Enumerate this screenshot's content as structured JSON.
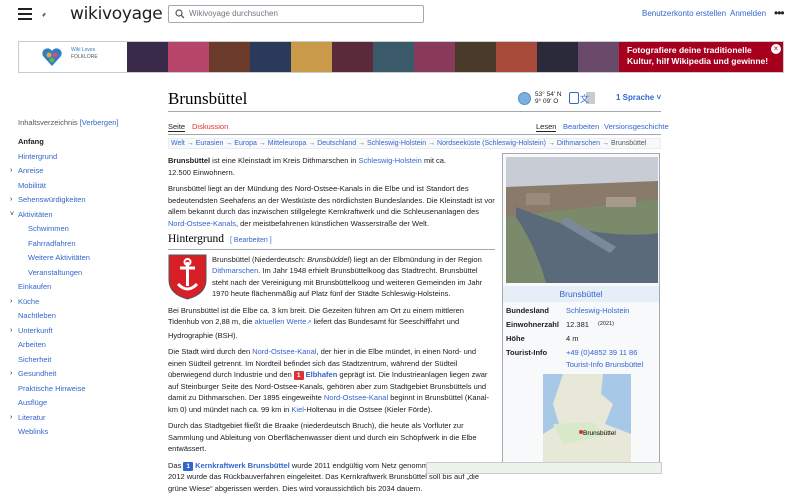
{
  "header": {
    "logo_text": "wikivoyage",
    "search_placeholder": "Wikivoyage durchsuchen",
    "create_account": "Benutzerkonto erstellen",
    "login": "Anmelden",
    "more": "•••"
  },
  "banner": {
    "wlm_line1": "Wiki Loves",
    "wlm_line2": "FOLKLORE",
    "text": "Fotografiere deine traditionelle Kultur, hilf Wikipedia und gewinne!",
    "close": "×"
  },
  "toc": {
    "title": "Inhaltsverzeichnis",
    "toggle": "[Verbergen]",
    "items": [
      {
        "label": "Anfang",
        "level": 0,
        "current": true,
        "chev": false
      },
      {
        "label": "Hintergrund",
        "level": 0,
        "chev": false
      },
      {
        "label": "Anreise",
        "level": 0,
        "chev": true,
        "chev_glyph": "›"
      },
      {
        "label": "Mobilität",
        "level": 0,
        "chev": false
      },
      {
        "label": "Sehenswürdigkeiten",
        "level": 0,
        "chev": true,
        "chev_glyph": "›"
      },
      {
        "label": "Aktivitäten",
        "level": 0,
        "chev": true,
        "chev_glyph": "˅"
      },
      {
        "label": "Schwimmen",
        "level": 1
      },
      {
        "label": "Fahrradfahren",
        "level": 1
      },
      {
        "label": "Weitere Aktivitäten",
        "level": 1
      },
      {
        "label": "Veranstaltungen",
        "level": 1
      },
      {
        "label": "Einkaufen",
        "level": 0,
        "chev": false
      },
      {
        "label": "Küche",
        "level": 0,
        "chev": true,
        "chev_glyph": "›"
      },
      {
        "label": "Nachtleben",
        "level": 0,
        "chev": false
      },
      {
        "label": "Unterkunft",
        "level": 0,
        "chev": true,
        "chev_glyph": "›"
      },
      {
        "label": "Arbeiten",
        "level": 0,
        "chev": false
      },
      {
        "label": "Sicherheit",
        "level": 0,
        "chev": false
      },
      {
        "label": "Gesundheit",
        "level": 0,
        "chev": true,
        "chev_glyph": "›"
      },
      {
        "label": "Praktische Hinweise",
        "level": 0,
        "chev": false
      },
      {
        "label": "Ausflüge",
        "level": 0,
        "chev": false
      },
      {
        "label": "Literatur",
        "level": 0,
        "chev": true,
        "chev_glyph": "›"
      },
      {
        "label": "Weblinks",
        "level": 0,
        "chev": false
      }
    ]
  },
  "page": {
    "title": "Brunsbüttel",
    "coord_lat": "53° 54′ N",
    "coord_lon": "9° 09′ O",
    "languages": "1 Sprache",
    "tab_page": "Seite",
    "tab_discussion": "Diskussion",
    "tab_read": "Lesen",
    "tab_edit": "Bearbeiten",
    "tab_history": "Versionsgeschichte",
    "breadcrumb": [
      "Welt",
      "Eurasien",
      "Europa",
      "Mitteleuropa",
      "Deutschland",
      "Schleswig-Holstein",
      "Nordseeküste (Schleswig-Holstein)",
      "Dithmarschen"
    ],
    "breadcrumb_current": "Brunsbüttel"
  },
  "content": {
    "p1_a": "Brunsbüttel",
    "p1_b": " ist eine Kleinstadt im Kreis Dithmarschen in ",
    "p1_link": "Schleswig-Holstein",
    "p1_c": " mit ca. 12.500 Einwohnern.",
    "p2_a": "Brunsbüttel liegt an der Mündung des Nord-Ostsee-Kanals in die Elbe und ist Standort des bedeutendsten Seehafens an der Westküste des nördlichsten Bundeslandes. Die Kleinstadt ist vor allem bekannt durch das inzwischen stillgelegte Kernkraftwerk und die Schleusenanlagen des ",
    "p2_link": "Nord-Ostsee-Kanals",
    "p2_b": ", der meistbefahrenen künstlichen Wasserstraße der Welt.",
    "h2": "Hintergrund",
    "h2_edit": "[ Bearbeiten ]",
    "p3_a": "Brunsbüttel (Niederdeutsch: ",
    "p3_i": "Brunsbüddel",
    "p3_b": ") liegt an der Elbmündung in der Region ",
    "p3_link": "Dithmarschen",
    "p3_c": ". Im Jahr 1948 erhielt Brunsbüttelkoog das Stadtrecht. Brunsbüttel steht nach der Vereinigung mit Brunsbüttelkoog und weiteren Gemeinden im Jahr 1970 heute flächenmäßig auf Platz fünf der Städte Schleswig-Holsteins.",
    "p4_a": "Bei Brunsbüttel ist die Elbe ca. 3 km breit. Die Gezeiten führen am Ort zu einem mittleren Tidenhub von 2,88 m, die ",
    "p4_link": "aktuellen Werte",
    "p4_b": " liefert das Bundesamt für Seeschifffahrt und Hydrographie (BSH).",
    "p5_a": "Die Stadt wird durch den ",
    "p5_link1": "Nord-Ostsee-Kanal",
    "p5_b": ", der hier in die Elbe mündet, in einen Nord- und einen Südteil getrennt. Im Nordteil befindet sich das Stadtzentrum, während der Südteil überwiegend durch Industrie und den ",
    "p5_badge": "1",
    "p5_link2": "Elbhafen",
    "p5_c": " geprägt ist. Die Industrieanlagen liegen zwar auf Steinburger Seite des Nord-Ostsee-Kanals, gehören aber zum Stadtgebiet Brunsbüttels und damit zu Dithmarschen. Der 1895 eingeweihte ",
    "p5_link3": "Nord-Ostsee-Kanal",
    "p5_d": " beginnt in Brunsbüttel (Kanal-km 0) und mündet nach ca. 99 km in ",
    "p5_link4": "Kiel",
    "p5_e": "-Holtenau in die Ostsee (Kieler Förde).",
    "p6": "Durch das Stadtgebiet fließt die Braake (niederdeutsch Bruch), die heute als Vorfluter zur Sammlung und Ableitung von Oberflächenwasser dient und durch ein Schöpfwerk in die Elbe entwässert.",
    "p7_a": "Das ",
    "p7_badge": "1",
    "p7_link": "Kernkraftwerk Brunsbüttel",
    "p7_b": " wurde 2011 endgültig vom Netz genommen. Im November 2012 wurde das Rückbauverfahren eingeleitet. Das Kernkraftwerk Brunsbüttel soll bis auf „die grüne Wiese“ abgerissen werden. Dies wird voraussichtlich bis 2034 dauern."
  },
  "infobox": {
    "title": "Brunsbüttel",
    "rows": [
      {
        "key": "Bundesland",
        "value": "Schleswig-Holstein",
        "link": true
      },
      {
        "key": "Einwohnerzahl",
        "value": "12.381",
        "note": "(2021)"
      },
      {
        "key": "Höhe",
        "value": "4 m"
      },
      {
        "key": "Tourist-Info",
        "value": "+49 (0)4852 39 11 86",
        "link": true
      }
    ],
    "tourist_link": "Tourist-Info Brunsbüttel",
    "map_label": "Brunsbüttel"
  },
  "colors": {
    "link": "#3366cc",
    "banner_red": "#a7001e",
    "badge_red": "#d33"
  }
}
